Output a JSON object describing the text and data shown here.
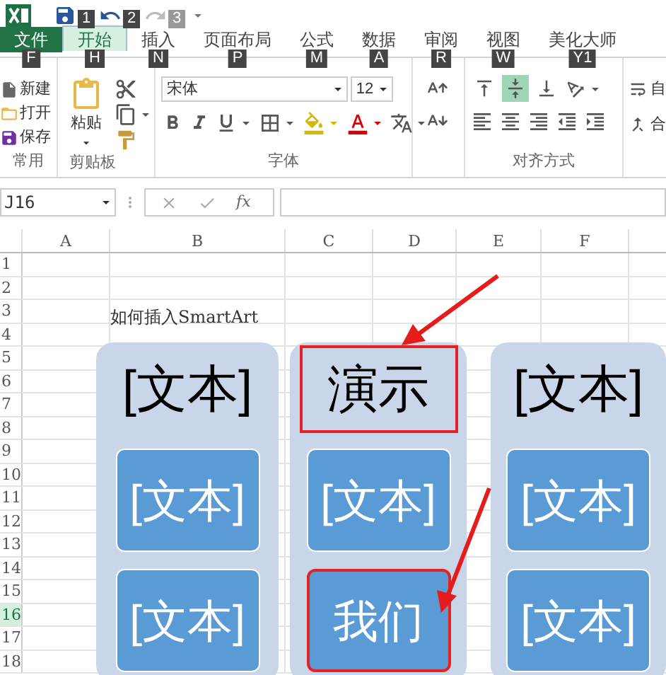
{
  "quick_access": [
    {
      "kind": "save",
      "keytip": "1",
      "disabled": false
    },
    {
      "kind": "undo",
      "keytip": "2",
      "disabled": false
    },
    {
      "kind": "redo",
      "keytip": "3",
      "disabled": true
    }
  ],
  "tabs": [
    {
      "label": "文件",
      "keytip": "F",
      "kind": "file",
      "selected": false
    },
    {
      "label": "开始",
      "keytip": "H",
      "kind": "tab",
      "selected": true
    },
    {
      "label": "插入",
      "keytip": "N",
      "kind": "tab",
      "selected": false
    },
    {
      "label": "页面布局",
      "keytip": "P",
      "kind": "tab",
      "selected": false
    },
    {
      "label": "公式",
      "keytip": "M",
      "kind": "tab",
      "selected": false
    },
    {
      "label": "数据",
      "keytip": "A",
      "kind": "tab",
      "selected": false
    },
    {
      "label": "审阅",
      "keytip": "R",
      "kind": "tab",
      "selected": false
    },
    {
      "label": "视图",
      "keytip": "W",
      "kind": "tab",
      "selected": false
    },
    {
      "label": "美化大师",
      "keytip": "Y1",
      "kind": "tab",
      "selected": false
    }
  ],
  "ribbon": {
    "common": {
      "label": "常用",
      "items": [
        {
          "kind": "new",
          "label": "新建"
        },
        {
          "kind": "open",
          "label": "打开"
        },
        {
          "kind": "save",
          "label": "保存"
        }
      ]
    },
    "clipboard": {
      "label": "剪贴板",
      "paste": "粘贴"
    },
    "font": {
      "label": "字体",
      "font_name": "宋体",
      "font_size": "12"
    },
    "alignment": {
      "label": "对齐方式",
      "vertical": [
        {
          "kind": "top",
          "selected": false
        },
        {
          "kind": "middle",
          "selected": true
        },
        {
          "kind": "bottom",
          "selected": false
        }
      ],
      "cut_labels": [
        "自",
        "合"
      ]
    }
  },
  "formula_bar": {
    "name_box": "J16",
    "function_symbol": "fx"
  },
  "sheet": {
    "columns": [
      "A",
      "B",
      "C",
      "D",
      "E",
      "F"
    ],
    "rows": [
      {
        "label": "1",
        "selected": false
      },
      {
        "label": "2",
        "selected": false
      },
      {
        "label": "3",
        "selected": false,
        "note": "如何插入SmartArt"
      },
      {
        "label": "4",
        "selected": false
      },
      {
        "label": "5",
        "selected": false
      },
      {
        "label": "6",
        "selected": false
      },
      {
        "label": "7",
        "selected": false
      },
      {
        "label": "8",
        "selected": false
      },
      {
        "label": "9",
        "selected": false
      },
      {
        "label": "10",
        "selected": false
      },
      {
        "label": "11",
        "selected": false
      },
      {
        "label": "12",
        "selected": false
      },
      {
        "label": "13",
        "selected": false
      },
      {
        "label": "14",
        "selected": false
      },
      {
        "label": "15",
        "selected": false
      },
      {
        "label": "16",
        "selected": true
      },
      {
        "label": "17",
        "selected": false
      },
      {
        "label": "18",
        "selected": false
      }
    ]
  },
  "smartart": {
    "columns": [
      {
        "title": "[文本]",
        "highlighted": false,
        "boxes": [
          {
            "text": "[文本]",
            "highlighted": false
          },
          {
            "text": "[文本]",
            "highlighted": false
          }
        ]
      },
      {
        "title": "演示",
        "highlighted": true,
        "boxes": [
          {
            "text": "[文本]",
            "highlighted": false
          },
          {
            "text": "我们",
            "highlighted": true
          }
        ]
      },
      {
        "title": "[文本]",
        "highlighted": false,
        "boxes": [
          {
            "text": "[文本]",
            "highlighted": false
          },
          {
            "text": "[文本]",
            "highlighted": false
          }
        ]
      }
    ]
  }
}
